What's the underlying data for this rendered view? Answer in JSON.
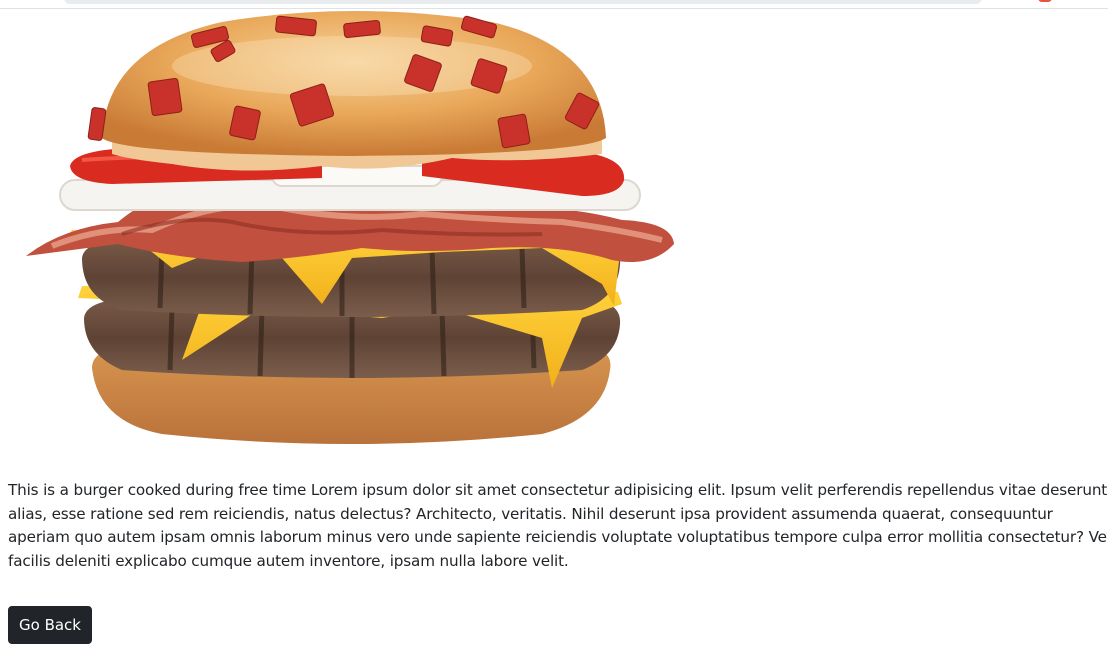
{
  "product": {
    "image_alt": "burger",
    "description": "This is a burger cooked during free time Lorem ipsum dolor sit amet consectetur adipisicing elit. Ipsum velit perferendis repellendus vitae deserunt alias, esse ratione sed rem reiciendis, natus delectus? Architecto, veritatis. Nihil deserunt ipsa provident assumenda quaerat, consequuntur aperiam quo autem ipsam omnis laborum minus vero unde sapiente reiciendis voluptate voluptatibus tempore culpa error mollitia consectetur? Vel facilis deleniti explicabo cumque autem inventore, ipsam nulla labore velit."
  },
  "actions": {
    "go_back_label": "Go Back"
  },
  "colors": {
    "button_bg": "#212529",
    "button_text": "#ffffff",
    "text": "#212529"
  }
}
